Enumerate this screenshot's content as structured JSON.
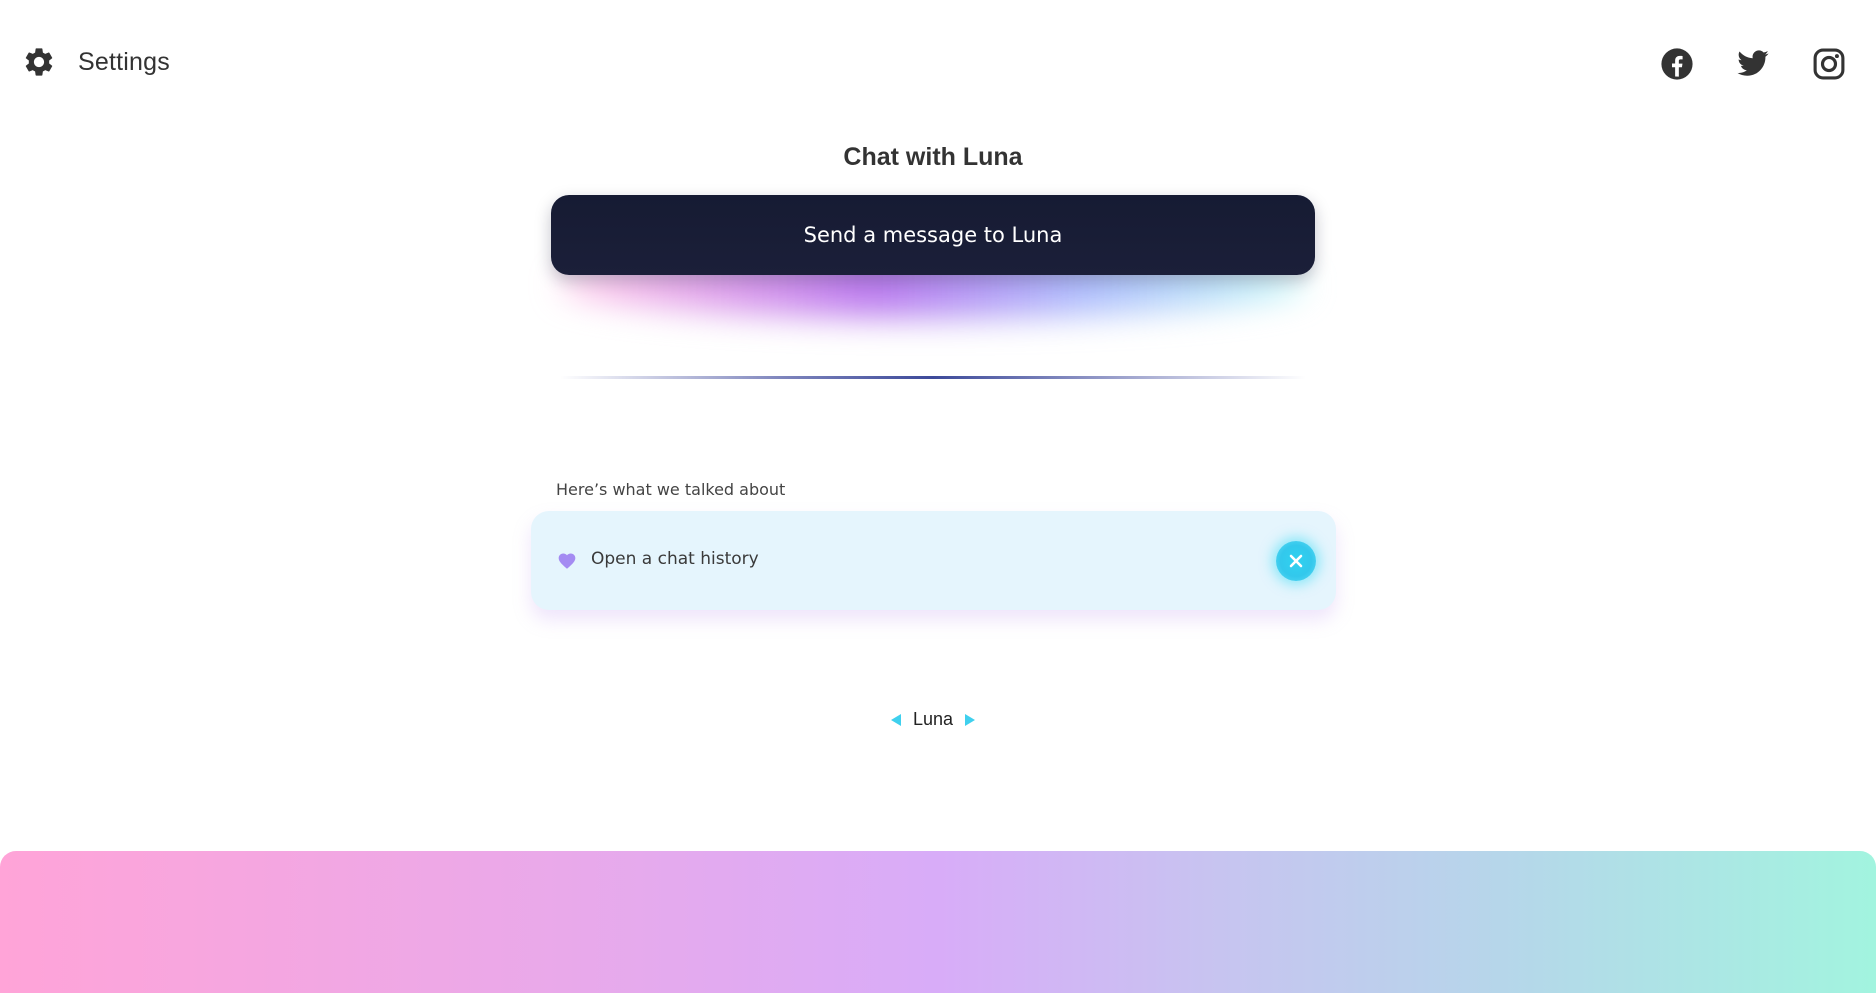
{
  "header": {
    "settings_label": "Settings",
    "settings_icon": "gear-icon",
    "socials": [
      {
        "name": "facebook",
        "icon": "facebook-icon"
      },
      {
        "name": "twitter",
        "icon": "twitter-icon"
      },
      {
        "name": "instagram",
        "icon": "instagram-icon"
      }
    ]
  },
  "main": {
    "title": "Chat with Luna",
    "send_button_label": "Send a message to Luna",
    "history_heading": "Here’s what we talked about",
    "history_item": {
      "label": "Open a chat history",
      "icon": "heart-icon",
      "close_icon": "close-icon"
    }
  },
  "pager": {
    "current": "Luna",
    "prev_icon": "triangle-left-icon",
    "next_icon": "triangle-right-icon"
  },
  "colors": {
    "button_bg": "#161b33",
    "card_bg": "#e5f5fd",
    "accent_cyan": "#2fd2f0",
    "heart": "#a48bf2",
    "footer_gradient": [
      "#ffa4d8",
      "#d8acf8",
      "#a2f4df"
    ]
  }
}
